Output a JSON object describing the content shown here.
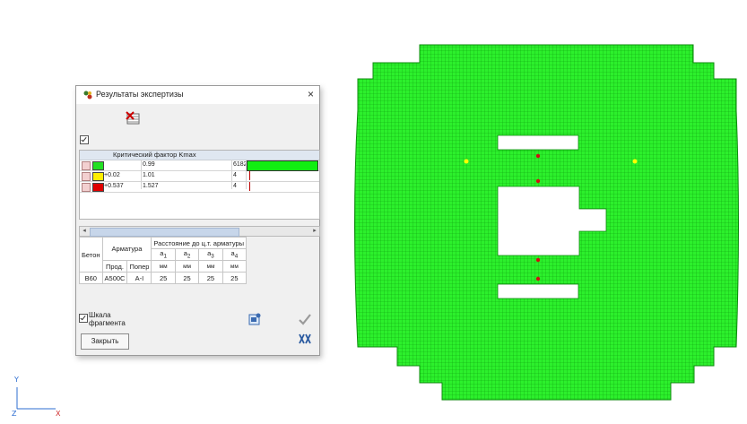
{
  "dialog": {
    "title": "Результаты экспертизы",
    "close_label": "×",
    "toolbar_icon": "delete-table-icon",
    "criterion_header": "Критический фактор Kmax",
    "rows": [
      {
        "color": "#22e022",
        "c1": "",
        "c2": "0.99",
        "c3": "6182",
        "bar_fraction": 1.0
      },
      {
        "color": "#ffee00",
        "c1": "+0.02",
        "c2": "1.01",
        "c3": "4",
        "bar_fraction": 0.0
      },
      {
        "color": "#e00000",
        "c1": "+0.537",
        "c2": "1.527",
        "c3": "4",
        "bar_fraction": 0.0
      }
    ],
    "scroll_left": "◂",
    "scroll_right": "▸",
    "armature_table": {
      "beton_header": "Бетон",
      "arm_header": "Арматура",
      "dist_header": "Расстояние до ц.т. арматуры",
      "prod": "Прод.",
      "poper": "Попер",
      "a1": "a",
      "s1": "1",
      "a2": "a",
      "s2": "2",
      "a3": "a",
      "s3": "3",
      "a4": "a",
      "s4": "4",
      "unit": "мм",
      "row": [
        "B60",
        "A500C",
        "A-I",
        "25",
        "25",
        "25",
        "25"
      ]
    },
    "scale_label_1": "Шкала",
    "scale_label_2": "фрагмента",
    "close_button": "Закрыть",
    "icons": [
      "settings-icon",
      "apply-check-icon",
      "cancel-icon"
    ]
  },
  "axes": {
    "x": "X",
    "y": "Y",
    "z": "Z"
  },
  "colors": {
    "mesh": "#22ee22",
    "mesh_line": "#0b9a0b",
    "marker_red": "#d01010",
    "marker_yellow": "#ffff00"
  }
}
